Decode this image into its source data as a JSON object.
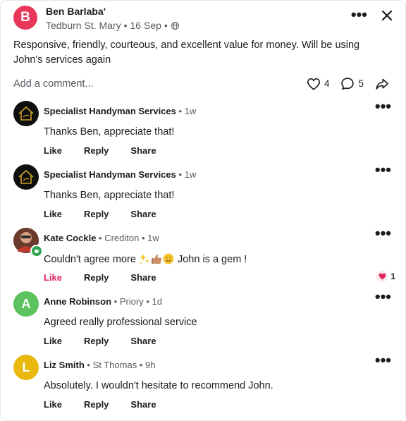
{
  "post": {
    "avatar_letter": "B",
    "author": "Ben Barlaba'",
    "location": "Tedburn St. Mary",
    "separator": "•",
    "date": "16 Sep",
    "body": "Responsive, friendly, courteous, and excellent value for money. Will be using John's services again",
    "add_comment_placeholder": "Add a comment...",
    "likes": "4",
    "comments": "5"
  },
  "comments": [
    {
      "name": "Specialist Handyman Services",
      "meta": "• 1w",
      "text": "Thanks Ben, appreciate that!",
      "like": "Like",
      "reply": "Reply",
      "share": "Share"
    },
    {
      "name": "Specialist Handyman Services",
      "meta": "• 1w",
      "text": "Thanks Ben, appreciate that!",
      "like": "Like",
      "reply": "Reply",
      "share": "Share"
    },
    {
      "name": "Kate Cockle",
      "meta": "• Crediton • 1w",
      "text_before": "Couldn't agree more ",
      "text_after": " John is a gem !",
      "like": "Like",
      "reply": "Reply",
      "share": "Share",
      "reaction_count": "1"
    },
    {
      "avatar_letter": "A",
      "name": "Anne Robinson",
      "meta": "• Priory • 1d",
      "text": "Agreed really professional service",
      "like": "Like",
      "reply": "Reply",
      "share": "Share"
    },
    {
      "avatar_letter": "L",
      "name": "Liz Smith",
      "meta": "• St Thomas • 9h",
      "text": "Absolutely. I wouldn't hesitate  to recommend John.",
      "like": "Like",
      "reply": "Reply",
      "share": "Share"
    }
  ],
  "icons": {
    "more": "more-horizontal-icon",
    "close": "close-icon",
    "globe": "globe-icon",
    "heart": "heart-icon",
    "comment": "comment-bubble-icon",
    "share": "share-arrow-icon"
  },
  "colors": {
    "post_avatar": "#e8375a",
    "liked": "#e0245e",
    "anne_avatar": "#5cc25e",
    "liz_avatar": "#e9b90d"
  }
}
